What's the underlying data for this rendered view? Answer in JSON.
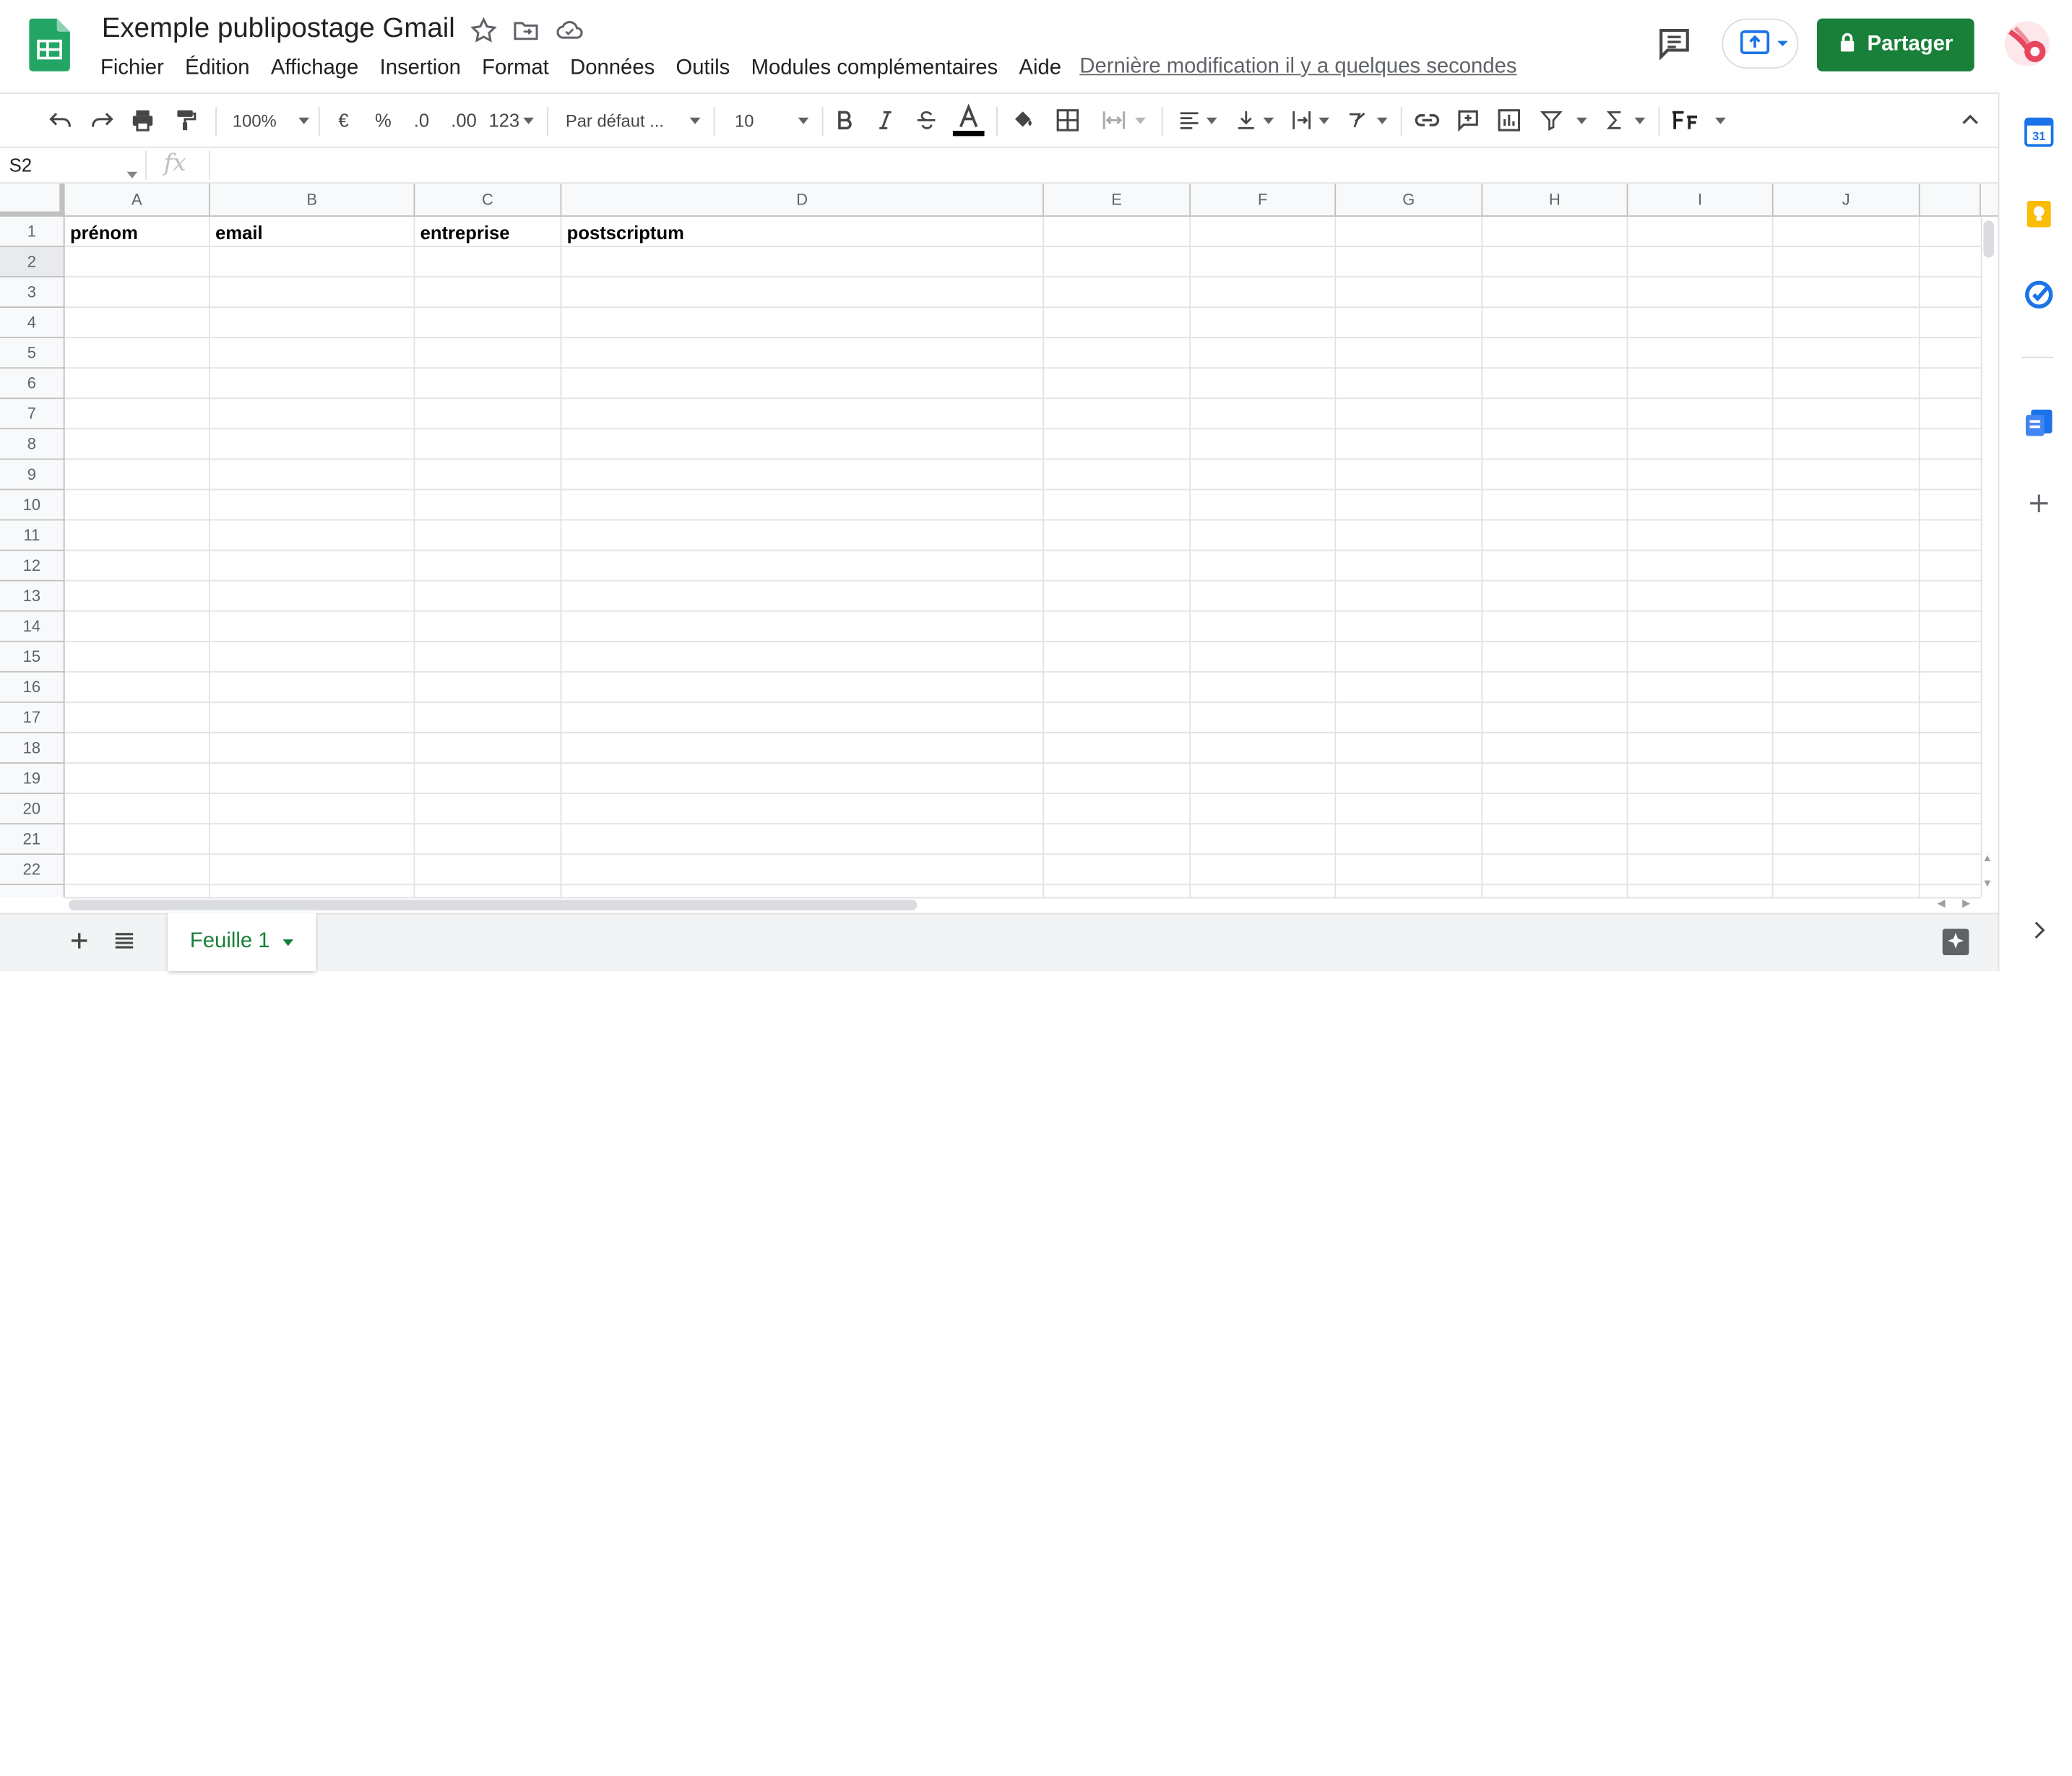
{
  "app": {
    "title": "Exemple publipostage Gmail",
    "last_edit": "Dernière modification il y a quelques secondes",
    "share_label": "Partager",
    "accent_color": "#188038"
  },
  "menu": [
    "Fichier",
    "Édition",
    "Affichage",
    "Insertion",
    "Format",
    "Données",
    "Outils",
    "Modules complémentaires",
    "Aide"
  ],
  "toolbar": {
    "zoom": "100%",
    "currency": "€",
    "percent": "%",
    "decrease_decimals": ".0",
    "increase_decimals": ".00",
    "more_formats": "123",
    "font": "Par défaut ...",
    "font_size": "10"
  },
  "formula_bar": {
    "name_box": "S2",
    "fx": "fx",
    "value": ""
  },
  "sheet": {
    "columns": [
      "A",
      "B",
      "C",
      "D",
      "E",
      "F",
      "G",
      "H",
      "I",
      "J"
    ],
    "rows": [
      "1",
      "2",
      "3",
      "4",
      "5",
      "6",
      "7",
      "8",
      "9",
      "10",
      "11",
      "12",
      "13",
      "14",
      "15",
      "16",
      "17",
      "18",
      "19",
      "20",
      "21",
      "22"
    ],
    "header_row": {
      "A": "prénom",
      "B": "email",
      "C": "entreprise",
      "D": "postscriptum"
    },
    "selected_row": "2"
  },
  "tabs": [
    {
      "label": "Feuille 1",
      "active": true
    }
  ],
  "side_panel": [
    "calendar-icon",
    "keep-icon",
    "tasks-icon",
    "contacts-icon",
    "add-icon"
  ]
}
